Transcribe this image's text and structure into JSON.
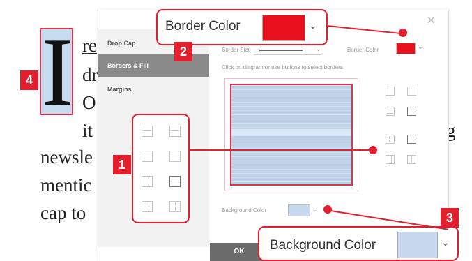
{
  "document": {
    "drop_cap_letter": "I",
    "lines": [
      "re",
      "dr",
      "O",
      "it",
      "g",
      "newsle",
      "mentic",
      "cap to"
    ]
  },
  "dialog": {
    "close_glyph": "×",
    "sidebar": {
      "items": [
        {
          "label": "Drop Cap",
          "active": false
        },
        {
          "label": "Borders & Fill",
          "active": true
        },
        {
          "label": "Margins",
          "active": false
        }
      ]
    },
    "border_size_label": "Border Size",
    "border_color_label": "Border Color",
    "border_color_value": "#e8101c",
    "instruction": "Click on diagram or use buttons to select borders",
    "background_color_label": "Background Color",
    "background_color_value": "#c6d9ef",
    "ok_label": "OK",
    "chevron": "⌄"
  },
  "callouts": {
    "border_color": {
      "label": "Border Color",
      "swatch": "#e8101c"
    },
    "background_color": {
      "label": "Background Color",
      "swatch": "#c6d9ef"
    },
    "badges": [
      "1",
      "2",
      "3",
      "4"
    ]
  },
  "colors": {
    "accent_red": "#e31e2d",
    "selected_item_bg": "#8a8a8a",
    "diagram_fill": "#bdd2e6"
  },
  "icons": [
    "border-top-icon",
    "border-middle-icon",
    "border-bottom-icon",
    "border-all-icon",
    "border-left-icon",
    "border-right-icon",
    "border-outer-icon",
    "border-inner-icon"
  ]
}
